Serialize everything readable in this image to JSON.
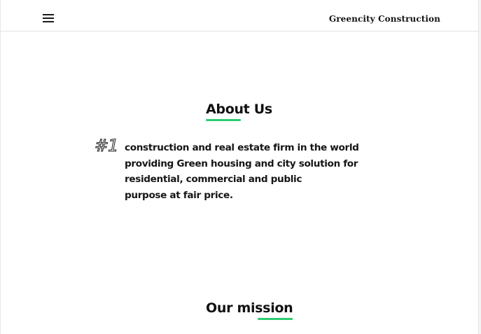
{
  "navbar": {
    "menu_icon": "hamburger-menu-icon",
    "brand": "Greencity Construction"
  },
  "about": {
    "title": "About Us",
    "badge": "#1",
    "lines": [
      "construction and real estate firm in the world",
      "providing Green housing and city solution for",
      "residential, commercial and public",
      "purpose at fair price."
    ]
  },
  "mission": {
    "title": "Our mission"
  },
  "colors": {
    "accent": "#2ecc71",
    "text": "#111111",
    "background": "#ffffff"
  }
}
